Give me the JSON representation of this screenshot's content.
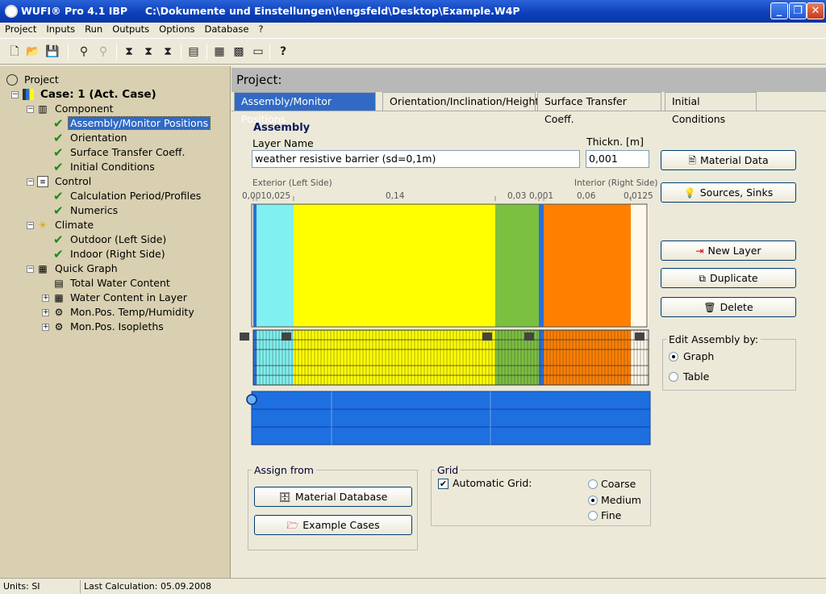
{
  "window": {
    "app_name": "WUFI® Pro 4.1 IBP",
    "file_path": "C:\\Dokumente und Einstellungen\\lengsfeld\\Desktop\\Example.W4P",
    "minimize": "_",
    "maximize": "❐",
    "close": "✕"
  },
  "menu": [
    "Project",
    "Inputs",
    "Run",
    "Outputs",
    "Options",
    "Database",
    "?"
  ],
  "toolbar": {
    "icons": [
      "new-file-icon",
      "open-folder-icon",
      "save-icon",
      "tree-icon",
      "tree-disabled-icon",
      "hourglass-icon",
      "hourglass-multi-icon",
      "hourglass-screen-icon",
      "window-icon",
      "grid-icon",
      "chart-grid-icon",
      "screen-icon",
      "help-icon"
    ],
    "help_label": "?"
  },
  "tree": {
    "project": "Project",
    "case": "Case: 1  (Act. Case)",
    "component": "Component",
    "assembly": "Assembly/Monitor Positions",
    "orientation": "Orientation",
    "surface": "Surface Transfer Coeff.",
    "initial": "Initial Conditions",
    "control": "Control",
    "calc_period": "Calculation Period/Profiles",
    "numerics": "Numerics",
    "climate": "Climate",
    "outdoor": "Outdoor (Left Side)",
    "indoor": "Indoor (Right Side)",
    "quick_graph": "Quick Graph",
    "total_water": "Total Water Content",
    "water_layer": "Water Content in Layer",
    "monpos_temp": "Mon.Pos. Temp/Humidity",
    "monpos_iso": "Mon.Pos. Isopleths"
  },
  "project_header": "Project:",
  "tabs": [
    "Assembly/Monitor Positions",
    "Orientation/Inclination/Height",
    "Surface Transfer Coeff.",
    "Initial Conditions"
  ],
  "assembly": {
    "heading": "Assembly",
    "layer_name_label": "Layer Name",
    "layer_name_value": "weather resistive barrier (sd=0,1m)",
    "thickness_label": "Thickn. [m]",
    "thickness_value": "0,001",
    "exterior_label": "Exterior (Left Side)",
    "interior_label": "Interior (Right Side)",
    "dims": [
      "0,0010,025",
      "0,14",
      "0,03",
      "0,001",
      "0,06",
      "0,0125"
    ]
  },
  "layers": [
    {
      "color": "#2a6fdb",
      "thickness": 0.001
    },
    {
      "color": "#80f0f0",
      "thickness": 0.025
    },
    {
      "color": "#ffff00",
      "thickness": 0.14
    },
    {
      "color": "#7cc040",
      "thickness": 0.03
    },
    {
      "color": "#2a6fdb",
      "thickness": 0.001
    },
    {
      "color": "#ff8000",
      "thickness": 0.06
    },
    {
      "color": "#fff8ec",
      "thickness": 0.0125
    }
  ],
  "buttons": {
    "material_data": "Material Data",
    "sources_sinks": "Sources, Sinks",
    "new_layer": "New Layer",
    "duplicate": "Duplicate",
    "delete": "Delete",
    "material_database": "Material Database",
    "example_cases": "Example Cases"
  },
  "edit_by": {
    "title": "Edit Assembly by:",
    "options": [
      "Graph",
      "Table"
    ],
    "selected": "Graph"
  },
  "assign_from": {
    "title": "Assign from"
  },
  "grid": {
    "title": "Grid",
    "automatic_label": "Automatic Grid:",
    "automatic_checked": true,
    "options": [
      "Coarse",
      "Medium",
      "Fine"
    ],
    "selected": "Medium"
  },
  "status": {
    "units": "Units: SI",
    "last_calc": "Last Calculation: 05.09.2008"
  }
}
